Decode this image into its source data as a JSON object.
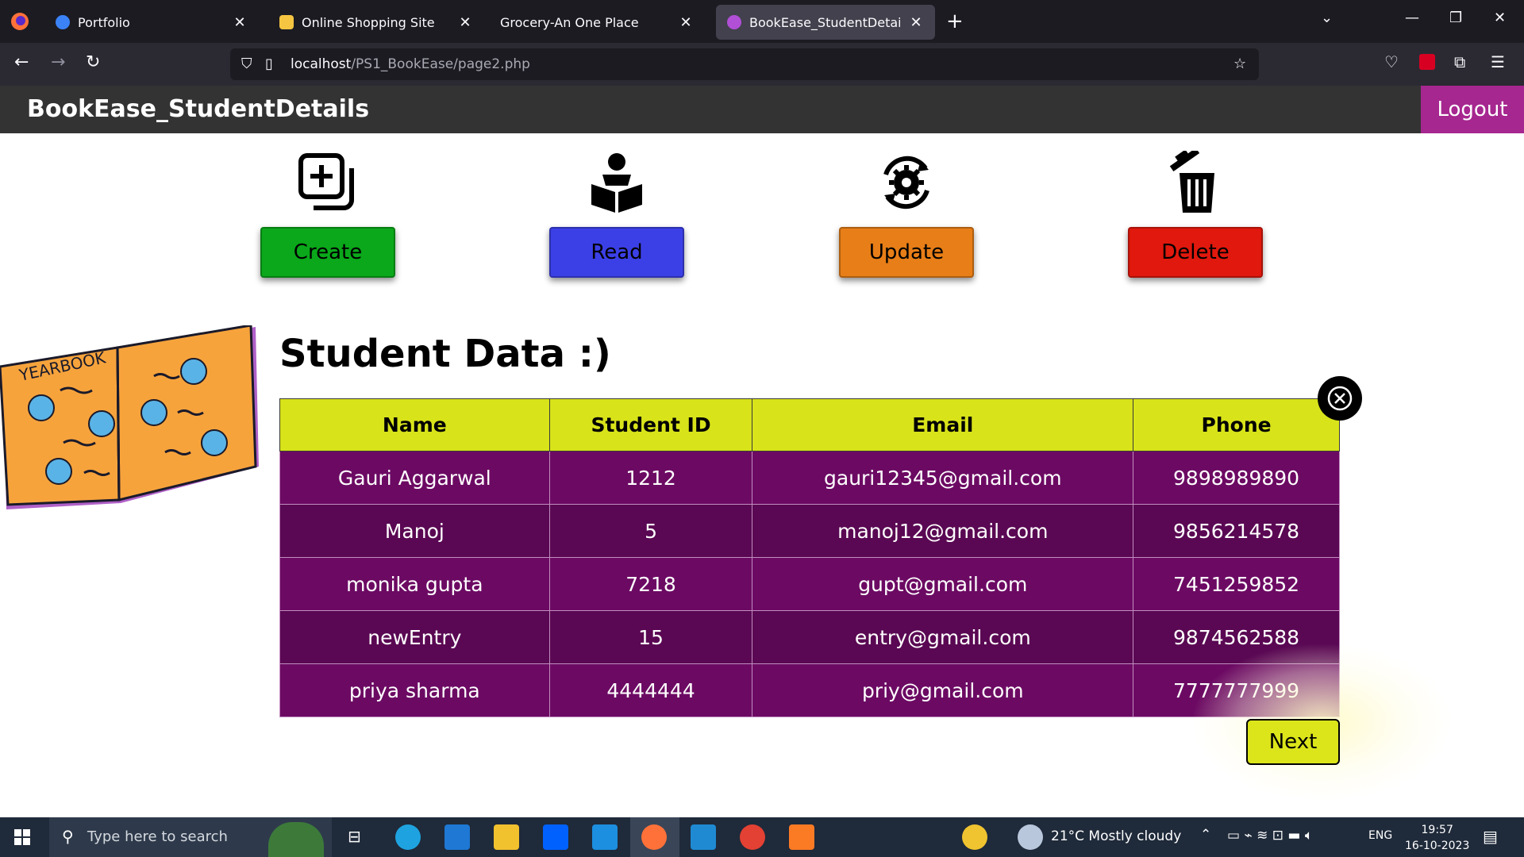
{
  "browser": {
    "tabs": [
      {
        "label": "Portfolio",
        "icon": "portfolio-tab-icon",
        "color": "#3b82f6"
      },
      {
        "label": "Online Shopping Site",
        "icon": "shopping-tab-icon",
        "color": "#f5c542"
      },
      {
        "label": "Grocery-An One Place",
        "icon": "",
        "color": ""
      },
      {
        "label": "BookEase_StudentDetails",
        "icon": "bookease-tab-icon",
        "color": "#b14fd6"
      }
    ],
    "url_host": "localhost",
    "url_path": "/PS1_BookEase/page2.php"
  },
  "header": {
    "title": "BookEase_StudentDetails",
    "logout_label": "Logout"
  },
  "actions": [
    {
      "label": "Create",
      "icon": "create-icon",
      "color": "#0aa81a"
    },
    {
      "label": "Read",
      "icon": "read-icon",
      "color": "#3b40e6"
    },
    {
      "label": "Update",
      "icon": "update-icon",
      "color": "#e77e17"
    },
    {
      "label": "Delete",
      "icon": "delete-icon",
      "color": "#e0180d"
    }
  ],
  "section": {
    "title": "Student Data :)"
  },
  "table": {
    "columns": [
      "Name",
      "Student ID",
      "Email",
      "Phone"
    ],
    "rows": [
      [
        "Gauri Aggarwal",
        "1212",
        "gauri12345@gmail.com",
        "9898989890"
      ],
      [
        "Manoj",
        "5",
        "manoj12@gmail.com",
        "9856214578"
      ],
      [
        "monika gupta",
        "7218",
        "gupt@gmail.com",
        "7451259852"
      ],
      [
        "newEntry",
        "15",
        "entry@gmail.com",
        "9874562588"
      ],
      [
        "priya sharma",
        "4444444",
        "priy@gmail.com",
        "7777777999"
      ]
    ]
  },
  "next_label": "Next",
  "taskbar": {
    "search_placeholder": "Type here to search",
    "weather": "21°C  Mostly cloudy",
    "language": "ENG",
    "time": "19:57",
    "date": "16-10-2023"
  },
  "colors": {
    "header_bg": "#333333",
    "logout_bg": "#a6278f",
    "table_header_bg": "#d8e31a",
    "table_row_bg": "#6c0a63",
    "next_bg": "#dbe51a"
  }
}
